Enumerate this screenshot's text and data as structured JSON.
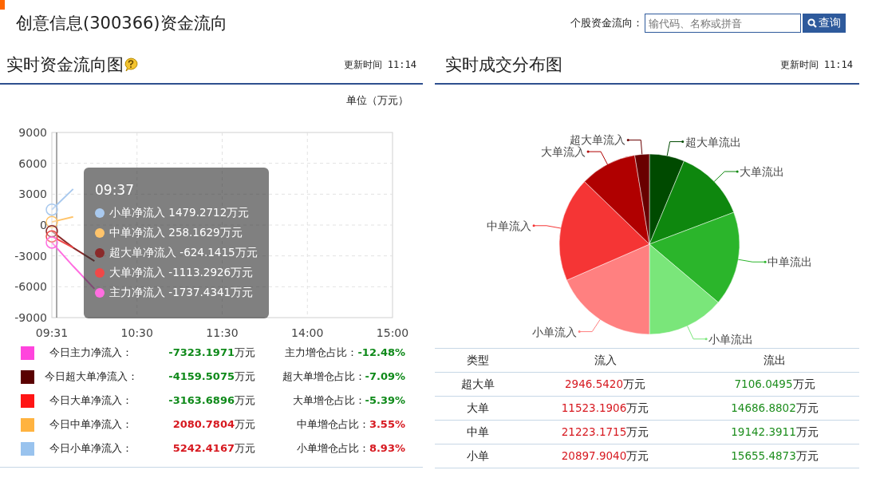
{
  "header": {
    "title": "创意信息(300366)资金流向",
    "search": {
      "label": "个股资金流向：",
      "placeholder": "输代码、名称或拼音",
      "button": "查询"
    }
  },
  "flow_panel": {
    "title": "实时资金流向图",
    "update": "更新时间 11:14",
    "unit": "单位（万元）",
    "chart_data": {
      "type": "line",
      "grid": true,
      "categories": [
        "09:31",
        null,
        null,
        null,
        "10:30",
        null,
        null,
        null,
        "11:30",
        null,
        null,
        null,
        "14:00",
        null,
        null,
        null,
        "15:00"
      ],
      "ylim": [
        -9000,
        9000
      ],
      "yticks": [
        9000,
        6000,
        3000,
        0,
        -3000,
        -6000,
        -9000
      ],
      "series": [
        {
          "name": "小单净流入",
          "color": "#a9c9ee",
          "values": [
            1500,
            3500,
            null,
            null,
            null,
            null,
            null,
            null,
            null,
            null,
            null,
            null,
            null,
            null,
            null,
            null,
            null
          ]
        },
        {
          "name": "中单净流入",
          "color": "#ffc46b",
          "values": [
            300,
            800,
            null,
            null,
            null,
            null,
            null,
            null,
            null,
            null,
            null,
            null,
            null,
            null,
            null,
            null,
            null
          ]
        },
        {
          "name": "超大单净流入",
          "color": "#8a2a2a",
          "values": [
            -600,
            -2200,
            -3500,
            null,
            null,
            null,
            null,
            null,
            null,
            null,
            null,
            null,
            null,
            null,
            null,
            null,
            null
          ]
        },
        {
          "name": "大单净流入",
          "color": "#f04848",
          "values": [
            -1100,
            -2200,
            null,
            null,
            null,
            null,
            null,
            null,
            null,
            null,
            null,
            null,
            null,
            null,
            null,
            null,
            null
          ]
        },
        {
          "name": "主力净流入",
          "color": "#ff6ee0",
          "values": [
            -1700,
            -4000,
            -6200,
            null,
            null,
            null,
            null,
            null,
            null,
            null,
            null,
            null,
            null,
            null,
            null,
            null,
            null
          ]
        }
      ]
    },
    "tooltip": {
      "time": "09:37",
      "values": [
        "1479.2712万元",
        "258.1629万元",
        "-624.1415万元",
        "-1113.2926万元",
        "-1737.4341万元"
      ]
    },
    "legend": [
      {
        "color": "#ff44dd",
        "label": "今日主力净流入：",
        "value": "-7323.1971",
        "unit": "万元",
        "ratio_label": "主力增仓占比：",
        "ratio": "-12.48%",
        "positive": false
      },
      {
        "color": "#5a0000",
        "label": "今日超大单净流入：",
        "value": "-4159.5075",
        "unit": "万元",
        "ratio_label": "超大单增仓占比：",
        "ratio": "-7.09%",
        "positive": false
      },
      {
        "color": "#ff1515",
        "label": "今日大单净流入：",
        "value": "-3163.6896",
        "unit": "万元",
        "ratio_label": "大单增仓占比：",
        "ratio": "-5.39%",
        "positive": false
      },
      {
        "color": "#ffb340",
        "label": "今日中单净流入：",
        "value": "2080.7804",
        "unit": "万元",
        "ratio_label": "中单增仓占比：",
        "ratio": "3.55%",
        "positive": true
      },
      {
        "color": "#99c3ee",
        "label": "今日小单净流入：",
        "value": "5242.4167",
        "unit": "万元",
        "ratio_label": "小单增仓占比：",
        "ratio": "8.93%",
        "positive": true
      }
    ]
  },
  "distribution_panel": {
    "title": "实时成交分布图",
    "update": "更新时间 11:14",
    "chart_data": {
      "type": "pie",
      "categories": [
        "超大单流出",
        "大单流出",
        "中单流出",
        "小单流出",
        "小单流入",
        "中单流入",
        "大单流入",
        "超大单流入"
      ],
      "values": [
        6.28,
        12.98,
        16.91,
        13.83,
        18.46,
        18.75,
        10.18,
        2.61
      ],
      "colors": [
        "#004a00",
        "#0e870e",
        "#2bb52b",
        "#7ae67a",
        "#ff8080",
        "#f53535",
        "#b00000",
        "#690000"
      ]
    },
    "table": {
      "columns": [
        "类型",
        "流入",
        "流出"
      ],
      "rows": [
        {
          "type": "超大单",
          "inflow": {
            "value": "2946.5420",
            "unit": "万元"
          },
          "outflow": {
            "value": "7106.0495",
            "unit": "万元"
          }
        },
        {
          "type": "大单",
          "inflow": {
            "value": "11523.1906",
            "unit": "万元"
          },
          "outflow": {
            "value": "14686.8802",
            "unit": "万元"
          }
        },
        {
          "type": "中单",
          "inflow": {
            "value": "21223.1715",
            "unit": "万元"
          },
          "outflow": {
            "value": "19142.3911",
            "unit": "万元"
          }
        },
        {
          "type": "小单",
          "inflow": {
            "value": "20897.9040",
            "unit": "万元"
          },
          "outflow": {
            "value": "15655.4873",
            "unit": "万元"
          }
        }
      ]
    }
  }
}
